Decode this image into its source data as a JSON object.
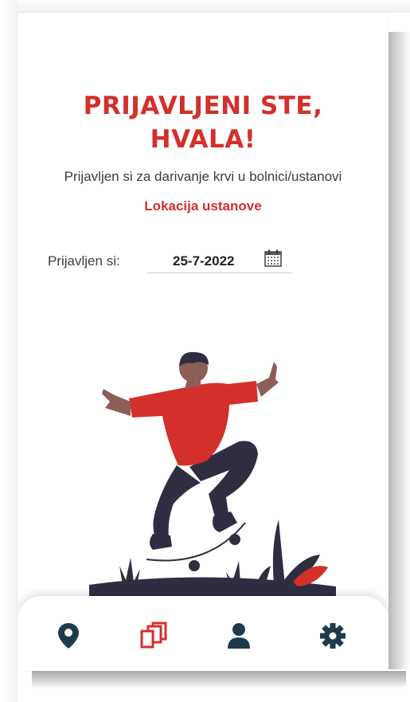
{
  "header": {
    "title_line1": "PRIJAVLJENI STE,",
    "title_line2": "HVALA!"
  },
  "info": {
    "subtitle": "Prijavljen si za darivanje krvi u bolnici/ustanovi",
    "location_link": "Lokacija ustanove"
  },
  "registration": {
    "label": "Prijavljen si:",
    "date": "25-7-2022"
  },
  "navbar": {
    "items": [
      {
        "icon": "map-marker-icon",
        "active": false
      },
      {
        "icon": "copy-icon",
        "active": true
      },
      {
        "icon": "user-icon",
        "active": false
      },
      {
        "icon": "gear-icon",
        "active": false
      }
    ]
  },
  "colors": {
    "accent": "#d3302b",
    "dark": "#1f3a4d",
    "text": "#3c3c3c"
  }
}
